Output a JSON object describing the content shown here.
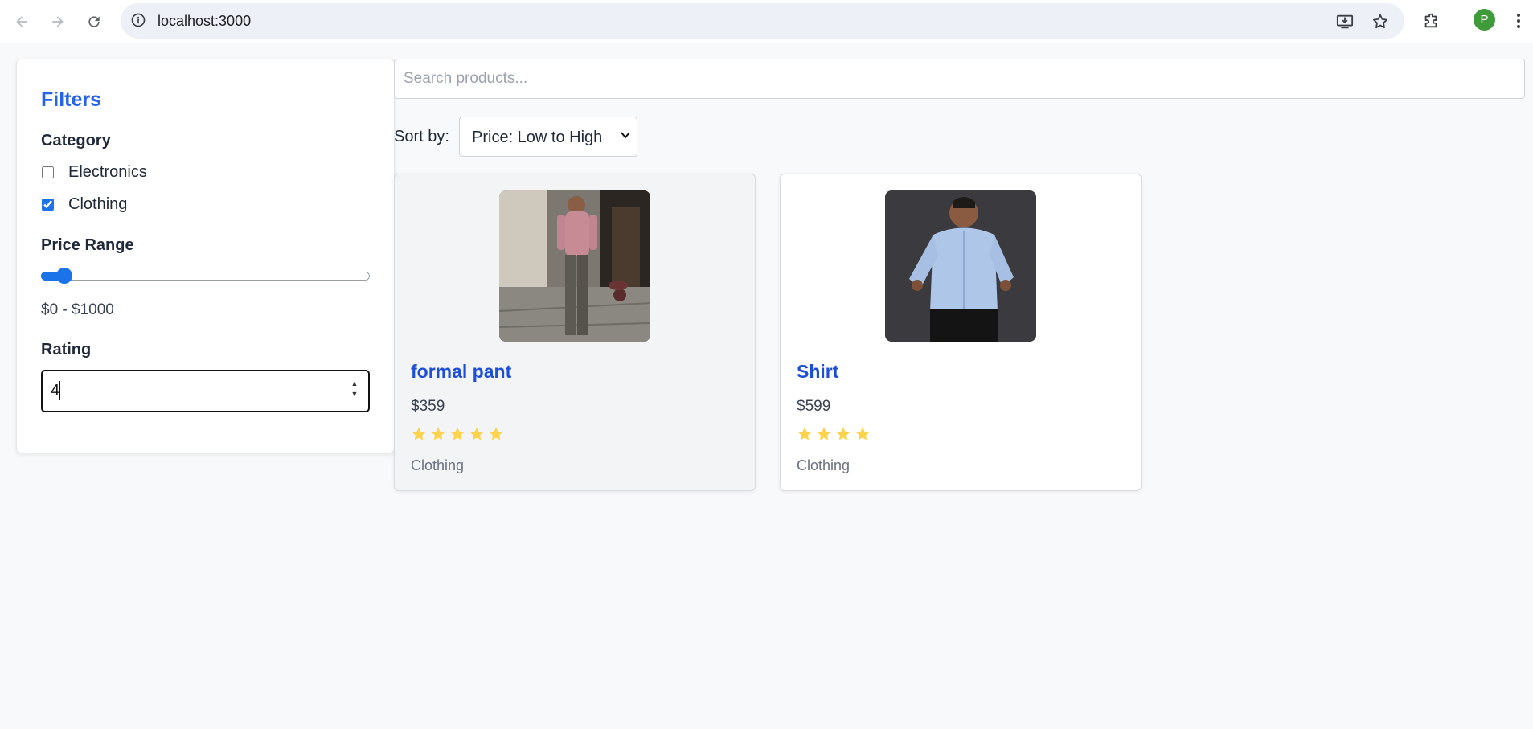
{
  "browser": {
    "url": "localhost:3000",
    "avatar_letter": "P",
    "icons": [
      "back-arrow-icon",
      "forward-arrow-icon",
      "reload-icon",
      "site-info-icon",
      "install-app-icon",
      "bookmark-star-icon",
      "extensions-icon",
      "more-vert-icon"
    ]
  },
  "filters": {
    "title": "Filters",
    "category_title": "Category",
    "categories": [
      {
        "label": "Electronics",
        "checked": false
      },
      {
        "label": "Clothing",
        "checked": true
      }
    ],
    "price_title": "Price Range",
    "price_range_text": "$0 - $1000",
    "rating_title": "Rating",
    "rating_value": "4"
  },
  "search": {
    "placeholder": "Search products..."
  },
  "sort": {
    "label": "Sort by:",
    "selected": "Price: Low to High"
  },
  "products": [
    {
      "name": "formal pant",
      "price": "$359",
      "rating": 5,
      "category": "Clothing"
    },
    {
      "name": "Shirt",
      "price": "$599",
      "rating": 4,
      "category": "Clothing"
    }
  ],
  "colors": {
    "accent": "#2563eb",
    "product_title": "#1d4ed8",
    "star": "#fcd34d",
    "checkbox": "#1a73e8"
  }
}
